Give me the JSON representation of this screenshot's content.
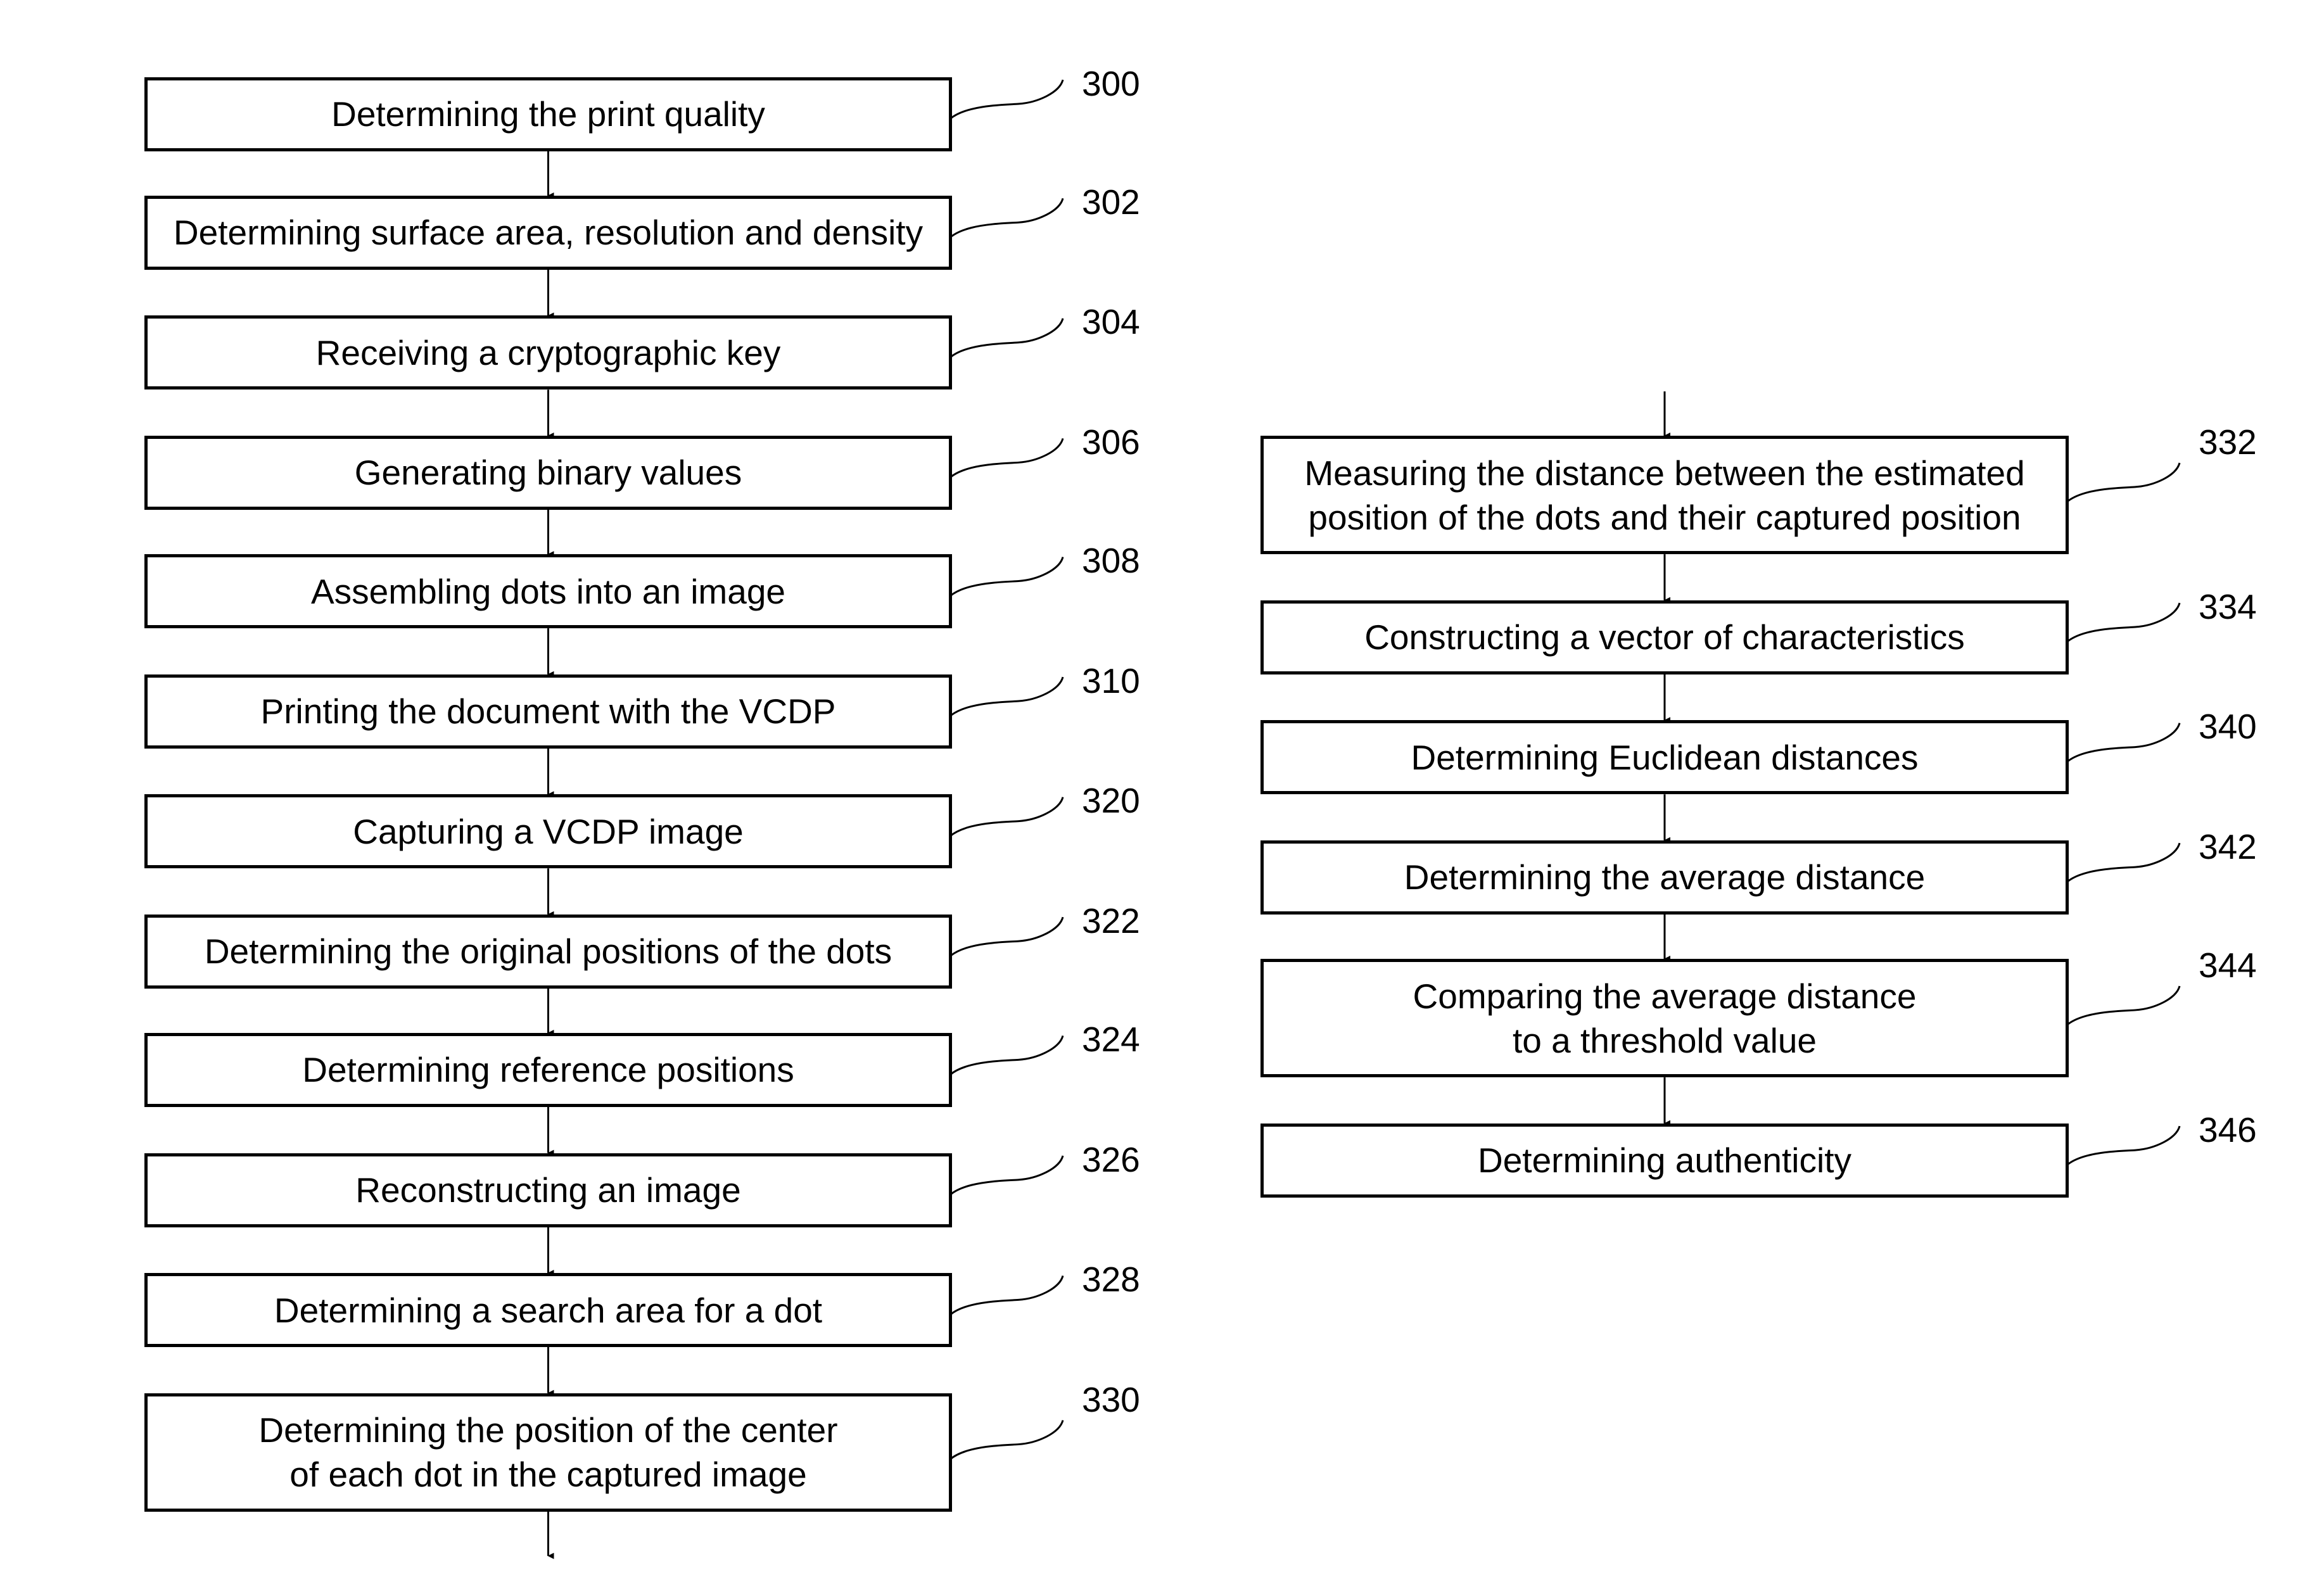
{
  "left_steps": [
    {
      "ref": "300",
      "text": "Determining the print quality"
    },
    {
      "ref": "302",
      "text": "Determining surface area, resolution and density"
    },
    {
      "ref": "304",
      "text": "Receiving a cryptographic key"
    },
    {
      "ref": "306",
      "text": "Generating binary values"
    },
    {
      "ref": "308",
      "text": "Assembling dots into an image"
    },
    {
      "ref": "310",
      "text": "Printing the document with the VCDP"
    },
    {
      "ref": "320",
      "text": "Capturing a VCDP image"
    },
    {
      "ref": "322",
      "text": "Determining the original positions of the dots"
    },
    {
      "ref": "324",
      "text": "Determining reference positions"
    },
    {
      "ref": "326",
      "text": "Reconstructing an image"
    },
    {
      "ref": "328",
      "text": "Determining a search area for a dot"
    },
    {
      "ref": "330",
      "text": "Determining the position of the center\nof each dot in the captured image"
    }
  ],
  "right_steps": [
    {
      "ref": "332",
      "text": "Measuring the distance between the estimated\nposition of the dots and their captured position"
    },
    {
      "ref": "334",
      "text": "Constructing a vector of characteristics"
    },
    {
      "ref": "340",
      "text": "Determining Euclidean distances"
    },
    {
      "ref": "342",
      "text": "Determining the average distance"
    },
    {
      "ref": "344",
      "text": "Comparing the average distance\nto a threshold value"
    },
    {
      "ref": "346",
      "text": "Determining authenticity"
    }
  ]
}
